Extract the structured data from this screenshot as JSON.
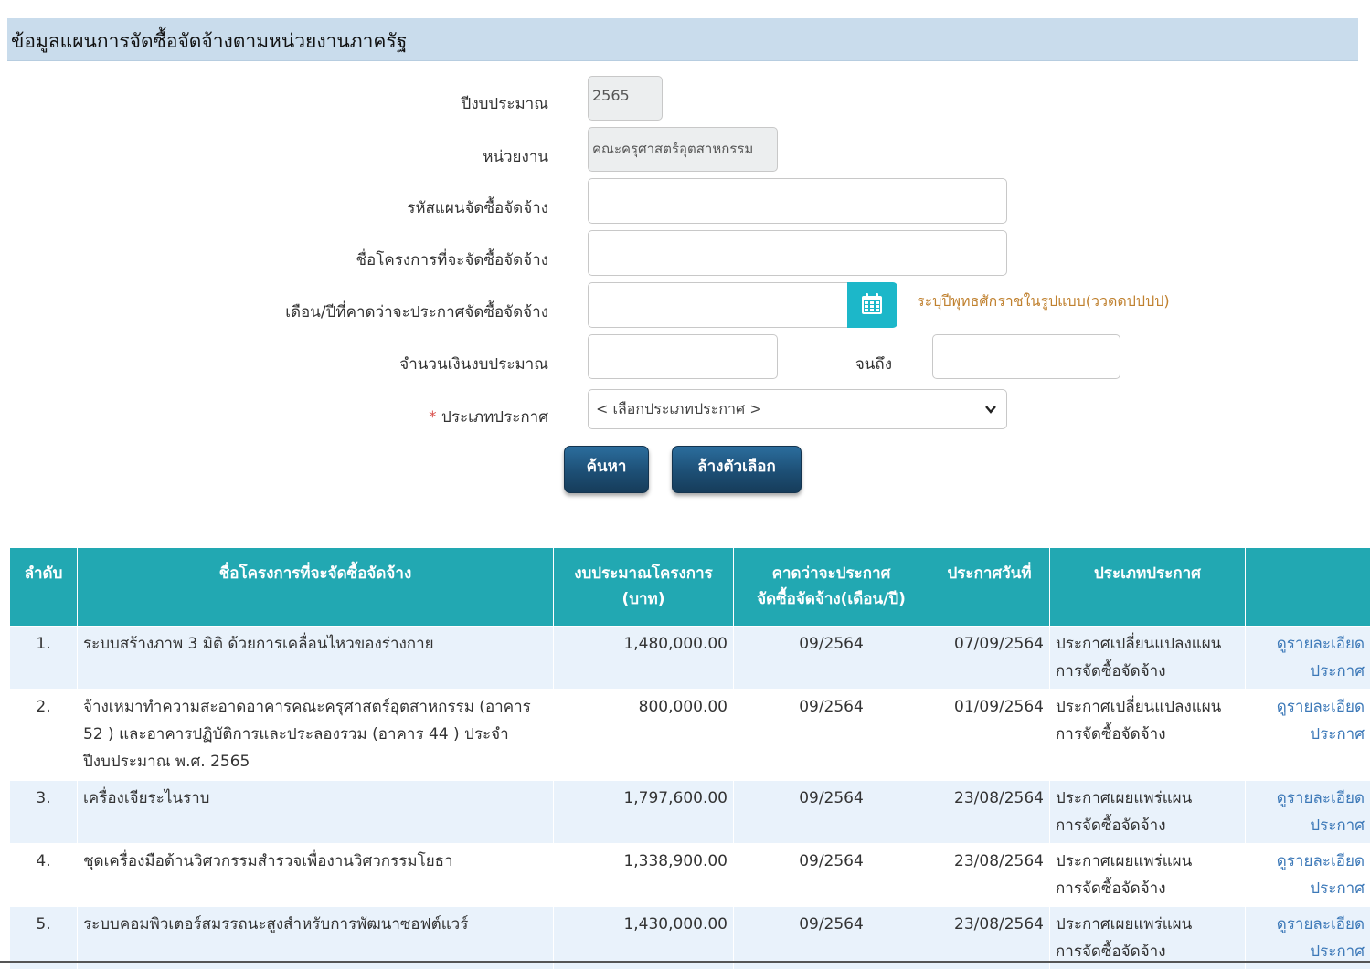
{
  "header": {
    "title": "ข้อมูลแผนการจัดซื้อจัดจ้างตามหน่วยงานภาครัฐ"
  },
  "form": {
    "fiscal_year_label": "ปีงบประมาณ",
    "fiscal_year_value": "2565",
    "agency_label": "หน่วยงาน",
    "agency_value": "คณะครุศาสตร์อุตสาหกรรม",
    "plan_code_label": "รหัสแผนจัดซื้อจัดจ้าง",
    "plan_code_value": "",
    "project_name_label": "ชื่อโครงการที่จะจัดซื้อจัดจ้าง",
    "project_name_value": "",
    "expected_month_label": "เดือน/ปีที่คาดว่าจะประกาศจัดซื้อจัดจ้าง",
    "expected_month_value": "",
    "expected_month_hint": "ระบุปีพุทธศักราชในรูปแบบ(ววดดปปปป)",
    "budget_label": "จำนวนเงินงบประมาณ",
    "budget_from_value": "",
    "budget_to_label": "จนถึง",
    "budget_to_value": "",
    "announce_type_required_mark": "*",
    "announce_type_label": "ประเภทประกาศ",
    "announce_type_selected": "< เลือกประเภทประกาศ >",
    "search_button": "ค้นหา",
    "clear_button": "ล้างตัวเลือก"
  },
  "table": {
    "headers": {
      "seq": "ลำดับ",
      "project": "ชื่อโครงการที่จะจัดซื้อจัดจ้าง",
      "budget_line1": "งบประมาณโครงการ",
      "budget_line2": "(บาท)",
      "expected_line1": "คาดว่าจะประกาศ",
      "expected_line2": "จัดซื้อจัดจ้าง(เดือน/ปี)",
      "announce_date": "ประกาศวันที่",
      "announce_type": "ประเภทประกาศ",
      "action": ""
    },
    "rows": [
      {
        "seq": "1.",
        "project": "ระบบสร้างภาพ 3 มิติ ด้วยการเคลื่อนไหวของร่างกาย",
        "budget": "1,480,000.00",
        "expected": "09/2564",
        "date": "07/09/2564",
        "type_line1": "ประกาศเปลี่ยนแปลงแผน",
        "type_line2": "การจัดซื้อจัดจ้าง",
        "link_line1": "ดูรายละเอียด",
        "link_line2": "ประกาศ"
      },
      {
        "seq": "2.",
        "project": "จ้างเหมาทำความสะอาดอาคารคณะครุศาสตร์อุตสาหกรรม (อาคาร 52 ) และอาคารปฏิบัติการและประลองรวม (อาคาร 44 ) ประจำปีงบประมาณ พ.ศ. 2565",
        "budget": "800,000.00",
        "expected": "09/2564",
        "date": "01/09/2564",
        "type_line1": "ประกาศเปลี่ยนแปลงแผน",
        "type_line2": "การจัดซื้อจัดจ้าง",
        "link_line1": "ดูรายละเอียด",
        "link_line2": "ประกาศ"
      },
      {
        "seq": "3.",
        "project": "เครื่องเจียระไนราบ",
        "budget": "1,797,600.00",
        "expected": "09/2564",
        "date": "23/08/2564",
        "type_line1": "ประกาศเผยแพร่แผน",
        "type_line2": "การจัดซื้อจัดจ้าง",
        "link_line1": "ดูรายละเอียด",
        "link_line2": "ประกาศ"
      },
      {
        "seq": "4.",
        "project": "ชุดเครื่องมือด้านวิศวกรรมสำรวจเพื่องานวิศวกรรมโยธา",
        "budget": "1,338,900.00",
        "expected": "09/2564",
        "date": "23/08/2564",
        "type_line1": "ประกาศเผยแพร่แผน",
        "type_line2": "การจัดซื้อจัดจ้าง",
        "link_line1": "ดูรายละเอียด",
        "link_line2": "ประกาศ"
      },
      {
        "seq": "5.",
        "project": "ระบบคอมพิวเตอร์สมรรถนะสูงสำหรับการพัฒนาซอฟต์แวร์",
        "budget": "1,430,000.00",
        "expected": "09/2564",
        "date": "23/08/2564",
        "type_line1": "ประกาศเผยแพร่แผน",
        "type_line2": "การจัดซื้อจัดจ้าง",
        "link_line1": "ดูรายละเอียด",
        "link_line2": "ประกาศ"
      }
    ]
  }
}
